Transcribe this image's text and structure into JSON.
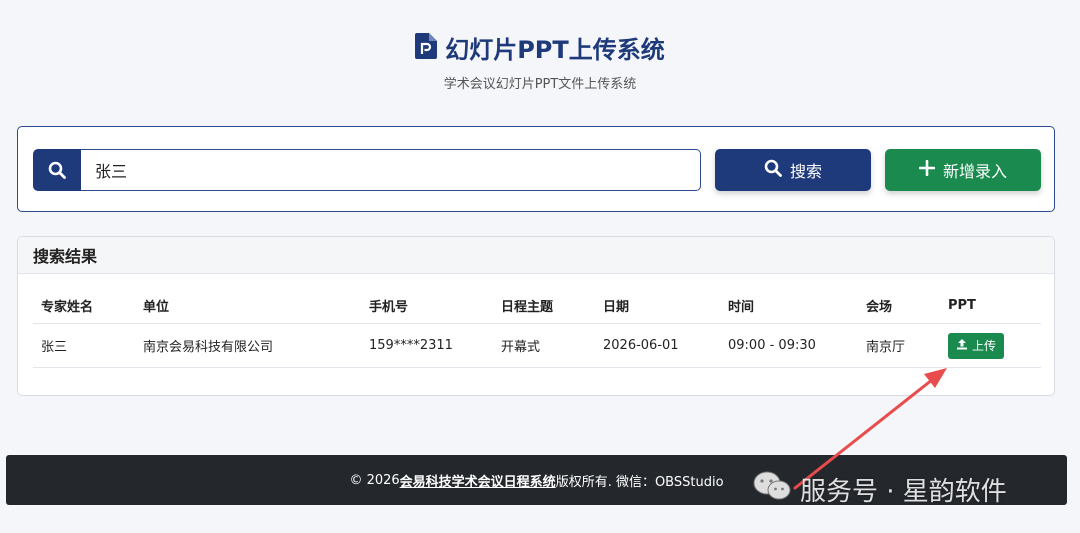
{
  "header": {
    "title": "幻灯片PPT上传系统",
    "subtitle": "学术会议幻灯片PPT文件上传系统",
    "icon": "file-powerpoint-icon"
  },
  "search": {
    "value": "张三",
    "search_label": "搜索",
    "add_label": "新增录入"
  },
  "results": {
    "title": "搜索结果",
    "columns": [
      "专家姓名",
      "单位",
      "手机号",
      "日程主题",
      "日期",
      "时间",
      "会场",
      "PPT"
    ],
    "rows": [
      {
        "name": "张三",
        "unit": "南京会易科技有限公司",
        "phone": "159****2311",
        "topic": "开幕式",
        "date": "2026-06-01",
        "time": "09:00 - 09:30",
        "venue": "南京厅",
        "upload_label": "上传"
      }
    ]
  },
  "footer": {
    "prefix": "© 2026 ",
    "link": "会易科技学术会议日程系统",
    "suffix": " 版权所有. 微信：OBSStudio"
  },
  "watermark": {
    "text": "服务号 · 星韵软件"
  },
  "colors": {
    "primary": "#1e3a7b",
    "success": "#1a8a4f",
    "footer_bg": "#24272c",
    "annotation": "#e94c4c"
  }
}
